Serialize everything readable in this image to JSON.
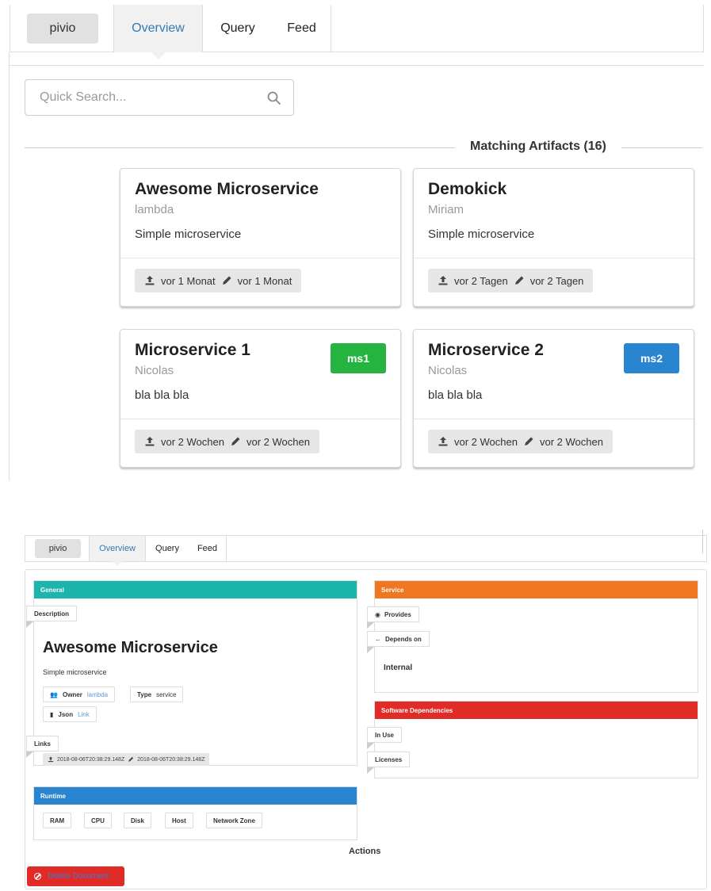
{
  "colors": {
    "link": "#337ab7",
    "general": "#1bb5ac",
    "runtime": "#2a85d0",
    "service": "#f07622",
    "dependencies": "#e02b27",
    "badge_green": "#26b441",
    "badge_blue": "#2a85d0",
    "delete": "#e02b27"
  },
  "overview": {
    "nav": {
      "brand": "pivio",
      "tabs": [
        {
          "label": "Overview",
          "active": true
        },
        {
          "label": "Query"
        },
        {
          "label": "Feed"
        }
      ]
    },
    "search": {
      "placeholder": "Quick Search...",
      "icon": "search-icon"
    },
    "matching_title": "Matching Artifacts (16)",
    "cards": [
      {
        "title": "Awesome Microservice",
        "owner": "lambda",
        "description": "Simple microservice",
        "created": "vor 1 Monat",
        "updated": "vor 1 Monat"
      },
      {
        "title": "Demokick",
        "owner": "Miriam",
        "description": "Simple microservice",
        "created": "vor 2 Tagen",
        "updated": "vor 2 Tagen"
      },
      {
        "title": "Microservice 1",
        "owner": "Nicolas",
        "description": "bla bla bla",
        "created": "vor 2 Wochen",
        "updated": "vor 2 Wochen",
        "badge": "ms1"
      },
      {
        "title": "Microservice 2",
        "owner": "Nicolas",
        "description": "bla bla bla",
        "created": "vor 2 Wochen",
        "updated": "vor 2 Wochen",
        "badge": "ms2"
      }
    ]
  },
  "detail": {
    "nav": {
      "brand": "pivio",
      "tabs": [
        {
          "label": "Overview",
          "active": true
        },
        {
          "label": "Query"
        },
        {
          "label": "Feed"
        }
      ]
    },
    "general": {
      "header": "General",
      "description_ribbon": "Description",
      "title": "Awesome Microservice",
      "description": "Simple microservice",
      "owner_label": "Owner",
      "owner_value": "lambda",
      "type_label": "Type",
      "type_value": "service",
      "json_label": "Json",
      "json_value": "Link",
      "links_ribbon": "Links",
      "created": "2018-08-06T20:38:29.148Z",
      "updated": "2018-08-06T20:38:29.148Z"
    },
    "runtime": {
      "header": "Runtime",
      "items": [
        "RAM",
        "CPU",
        "Disk",
        "Host",
        "Network Zone"
      ]
    },
    "service": {
      "header": "Service",
      "provides": "Provides",
      "depends_on": "Depends on",
      "internal": "Internal"
    },
    "software_dependencies": {
      "header": "Software Dependencies",
      "in_use": "In Use",
      "licenses": "Licenses"
    },
    "actions": {
      "title": "Actions",
      "delete": "Delete Document"
    }
  }
}
